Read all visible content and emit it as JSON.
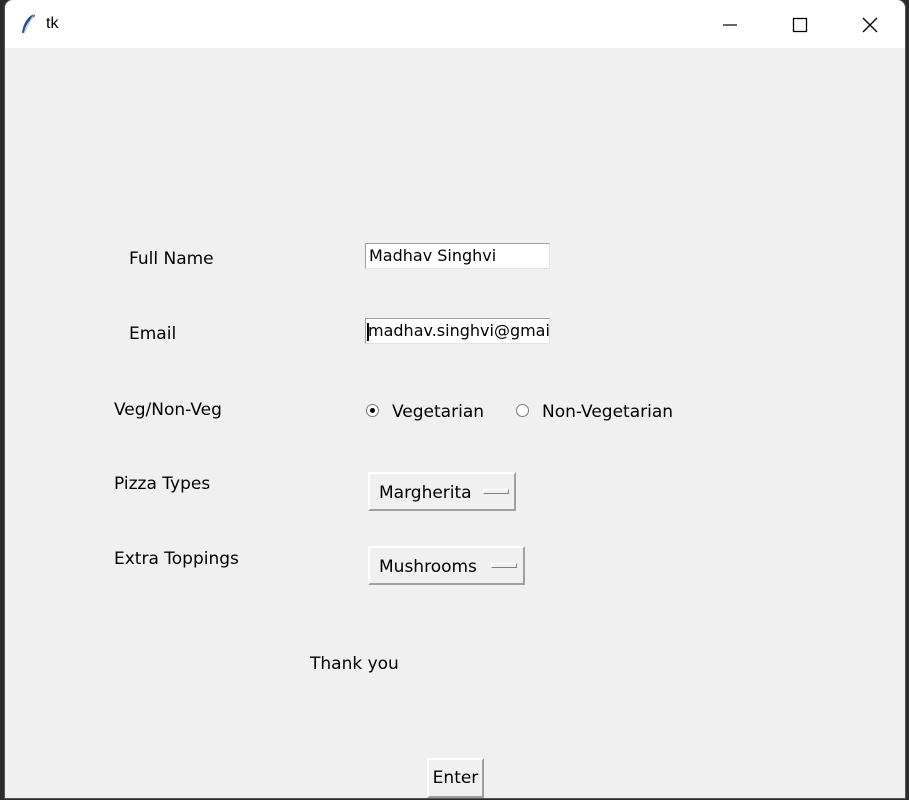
{
  "window": {
    "title": "tk"
  },
  "form": {
    "full_name": {
      "label": "Full Name",
      "value": "Madhav Singhvi"
    },
    "email": {
      "label": "Email",
      "value": "madhav.singhvi@gmai"
    },
    "diet": {
      "label": "Veg/Non-Veg",
      "options": [
        "Vegetarian",
        "Non-Vegetarian"
      ],
      "selected": "Vegetarian"
    },
    "pizza_type": {
      "label": "Pizza Types",
      "selected": "Margherita"
    },
    "toppings": {
      "label": "Extra Toppings",
      "selected": "Mushrooms"
    },
    "message": "Thank you",
    "submit_label": "Enter"
  }
}
